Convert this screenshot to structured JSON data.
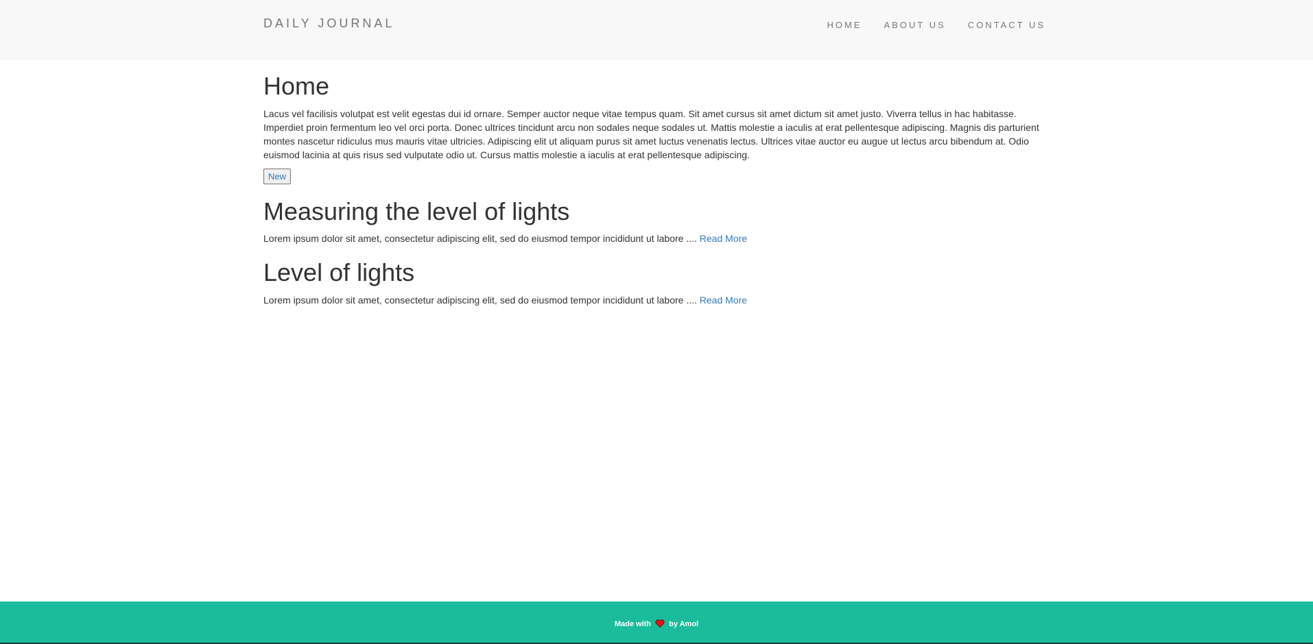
{
  "header": {
    "brand": "DAILY JOURNAL",
    "nav": [
      {
        "label": "HOME"
      },
      {
        "label": "ABOUT US"
      },
      {
        "label": "CONTACT US"
      }
    ]
  },
  "main": {
    "title": "Home",
    "intro": "Lacus vel facilisis volutpat est velit egestas dui id ornare. Semper auctor neque vitae tempus quam. Sit amet cursus sit amet dictum sit amet justo. Viverra tellus in hac habitasse. Imperdiet proin fermentum leo vel orci porta. Donec ultrices tincidunt arcu non sodales neque sodales ut. Mattis molestie a iaculis at erat pellentesque adipiscing. Magnis dis parturient montes nascetur ridiculus mus mauris vitae ultricies. Adipiscing elit ut aliquam purus sit amet luctus venenatis lectus. Ultrices vitae auctor eu augue ut lectus arcu bibendum at. Odio euismod lacinia at quis risus sed vulputate odio ut. Cursus mattis molestie a iaculis at erat pellentesque adipiscing.",
    "new_button": "New",
    "posts": [
      {
        "title": "Measuring the level of lights",
        "excerpt": "Lorem ipsum dolor sit amet, consectetur adipiscing elit, sed do eiusmod tempor incididunt ut labore ....",
        "read_more": "Read More"
      },
      {
        "title": "Level of lights",
        "excerpt": "Lorem ipsum dolor sit amet, consectetur adipiscing elit, sed do eiusmod tempor incididunt ut labore ....",
        "read_more": "Read More"
      }
    ]
  },
  "footer": {
    "made_with": "Made with",
    "by": "by Amol",
    "heart_icon": "heart-icon",
    "heart_color": "#e0151b",
    "background_color": "#1abc9c"
  }
}
